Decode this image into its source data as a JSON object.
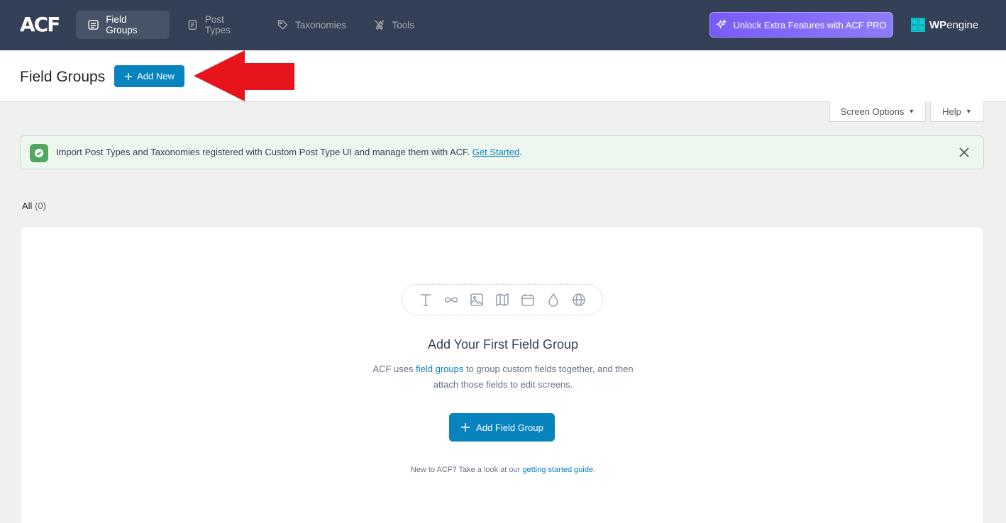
{
  "nav": {
    "logo": "ACF",
    "items": [
      {
        "label": "Field Groups",
        "icon": "list-icon"
      },
      {
        "label": "Post Types",
        "icon": "document-icon"
      },
      {
        "label": "Taxonomies",
        "icon": "tag-icon"
      },
      {
        "label": "Tools",
        "icon": "tools-icon"
      }
    ],
    "pro_label": "Unlock Extra Features with ACF PRO",
    "wpengine_bold": "WP",
    "wpengine_rest": "engine"
  },
  "header": {
    "title": "Field Groups",
    "add_new_label": "Add New"
  },
  "screen_options_label": "Screen Options",
  "help_label": "Help",
  "notice": {
    "text": "Import Post Types and Taxonomies registered with Custom Post Type UI and manage them with ACF.",
    "link": "Get Started",
    "tail": "."
  },
  "filter": {
    "all_label": "All",
    "all_count": "(0)"
  },
  "empty": {
    "title": "Add Your First Field Group",
    "desc_pre": "ACF uses",
    "desc_link": "field groups",
    "desc_post": "to group custom fields together, and then attach those fields to edit screens.",
    "button_label": "Add Field Group",
    "guide_pre": "New to ACF? Take a look at our",
    "guide_link": "getting started guide",
    "guide_post": "."
  },
  "colors": {
    "topbar": "#344055",
    "primary": "#0783be",
    "pro_gradient_start": "#7a5af8",
    "notice_green": "#52a85f",
    "annotation_arrow": "#e8141c"
  }
}
